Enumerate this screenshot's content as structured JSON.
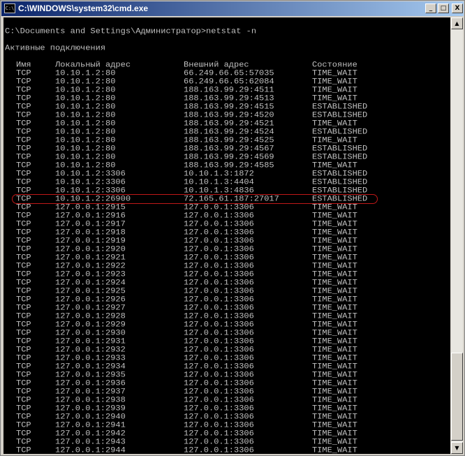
{
  "window": {
    "title": "C:\\WINDOWS\\system32\\cmd.exe",
    "icon_label": "C:\\",
    "icons": {
      "minimize": "minimize-icon",
      "maximize": "maximize-icon",
      "close": "close-icon"
    },
    "buttons": {
      "minimize": "_",
      "maximize": "□",
      "close": "X"
    }
  },
  "console": {
    "command": "C:\\Documents and Settings\\Администратор>netstat -n",
    "heading": "Активные подключения",
    "columns": {
      "proto": "Имя",
      "local": "Локальный адрес",
      "foreign": "Внешний адрес",
      "state": "Состояние"
    },
    "highlight_color": "#c01818",
    "highlighted_row": 13,
    "rows": [
      {
        "proto": "TCP",
        "local": "10.10.1.2:80",
        "foreign": "66.249.66.65:57035",
        "state": "TIME_WAIT"
      },
      {
        "proto": "TCP",
        "local": "10.10.1.2:80",
        "foreign": "66.249.66.65:62084",
        "state": "TIME_WAIT"
      },
      {
        "proto": "TCP",
        "local": "10.10.1.2:80",
        "foreign": "188.163.99.29:4511",
        "state": "TIME_WAIT"
      },
      {
        "proto": "TCP",
        "local": "10.10.1.2:80",
        "foreign": "188.163.99.29:4513",
        "state": "TIME_WAIT"
      },
      {
        "proto": "TCP",
        "local": "10.10.1.2:80",
        "foreign": "188.163.99.29:4515",
        "state": "ESTABLISHED"
      },
      {
        "proto": "TCP",
        "local": "10.10.1.2:80",
        "foreign": "188.163.99.29:4520",
        "state": "ESTABLISHED"
      },
      {
        "proto": "TCP",
        "local": "10.10.1.2:80",
        "foreign": "188.163.99.29:4521",
        "state": "TIME_WAIT"
      },
      {
        "proto": "TCP",
        "local": "10.10.1.2:80",
        "foreign": "188.163.99.29:4524",
        "state": "ESTABLISHED"
      },
      {
        "proto": "TCP",
        "local": "10.10.1.2:80",
        "foreign": "188.163.99.29:4525",
        "state": "TIME_WAIT"
      },
      {
        "proto": "TCP",
        "local": "10.10.1.2:80",
        "foreign": "188.163.99.29:4567",
        "state": "ESTABLISHED"
      },
      {
        "proto": "TCP",
        "local": "10.10.1.2:80",
        "foreign": "188.163.99.29:4569",
        "state": "ESTABLISHED"
      },
      {
        "proto": "TCP",
        "local": "10.10.1.2:80",
        "foreign": "188.163.99.29:4585",
        "state": "TIME_WAIT"
      },
      {
        "proto": "TCP",
        "local": "10.10.1.2:3306",
        "foreign": "10.10.1.3:1872",
        "state": "ESTABLISHED"
      },
      {
        "proto": "TCP",
        "local": "10.10.1.2:3306",
        "foreign": "10.10.1.3:4404",
        "state": "ESTABLISHED"
      },
      {
        "proto": "TCP",
        "local": "10.10.1.2:3306",
        "foreign": "10.10.1.3:4836",
        "state": "ESTABLISHED"
      },
      {
        "proto": "TCP",
        "local": "10.10.1.2:26900",
        "foreign": "72.165.61.187:27017",
        "state": "ESTABLISHED"
      },
      {
        "proto": "TCP",
        "local": "127.0.0.1:2915",
        "foreign": "127.0.0.1:3306",
        "state": "TIME_WAIT"
      },
      {
        "proto": "TCP",
        "local": "127.0.0.1:2916",
        "foreign": "127.0.0.1:3306",
        "state": "TIME_WAIT"
      },
      {
        "proto": "TCP",
        "local": "127.0.0.1:2917",
        "foreign": "127.0.0.1:3306",
        "state": "TIME_WAIT"
      },
      {
        "proto": "TCP",
        "local": "127.0.0.1:2918",
        "foreign": "127.0.0.1:3306",
        "state": "TIME_WAIT"
      },
      {
        "proto": "TCP",
        "local": "127.0.0.1:2919",
        "foreign": "127.0.0.1:3306",
        "state": "TIME_WAIT"
      },
      {
        "proto": "TCP",
        "local": "127.0.0.1:2920",
        "foreign": "127.0.0.1:3306",
        "state": "TIME_WAIT"
      },
      {
        "proto": "TCP",
        "local": "127.0.0.1:2921",
        "foreign": "127.0.0.1:3306",
        "state": "TIME_WAIT"
      },
      {
        "proto": "TCP",
        "local": "127.0.0.1:2922",
        "foreign": "127.0.0.1:3306",
        "state": "TIME_WAIT"
      },
      {
        "proto": "TCP",
        "local": "127.0.0.1:2923",
        "foreign": "127.0.0.1:3306",
        "state": "TIME_WAIT"
      },
      {
        "proto": "TCP",
        "local": "127.0.0.1:2924",
        "foreign": "127.0.0.1:3306",
        "state": "TIME_WAIT"
      },
      {
        "proto": "TCP",
        "local": "127.0.0.1:2925",
        "foreign": "127.0.0.1:3306",
        "state": "TIME_WAIT"
      },
      {
        "proto": "TCP",
        "local": "127.0.0.1:2926",
        "foreign": "127.0.0.1:3306",
        "state": "TIME_WAIT"
      },
      {
        "proto": "TCP",
        "local": "127.0.0.1:2927",
        "foreign": "127.0.0.1:3306",
        "state": "TIME_WAIT"
      },
      {
        "proto": "TCP",
        "local": "127.0.0.1:2928",
        "foreign": "127.0.0.1:3306",
        "state": "TIME_WAIT"
      },
      {
        "proto": "TCP",
        "local": "127.0.0.1:2929",
        "foreign": "127.0.0.1:3306",
        "state": "TIME_WAIT"
      },
      {
        "proto": "TCP",
        "local": "127.0.0.1:2930",
        "foreign": "127.0.0.1:3306",
        "state": "TIME_WAIT"
      },
      {
        "proto": "TCP",
        "local": "127.0.0.1:2931",
        "foreign": "127.0.0.1:3306",
        "state": "TIME_WAIT"
      },
      {
        "proto": "TCP",
        "local": "127.0.0.1:2932",
        "foreign": "127.0.0.1:3306",
        "state": "TIME_WAIT"
      },
      {
        "proto": "TCP",
        "local": "127.0.0.1:2933",
        "foreign": "127.0.0.1:3306",
        "state": "TIME_WAIT"
      },
      {
        "proto": "TCP",
        "local": "127.0.0.1:2934",
        "foreign": "127.0.0.1:3306",
        "state": "TIME_WAIT"
      },
      {
        "proto": "TCP",
        "local": "127.0.0.1:2935",
        "foreign": "127.0.0.1:3306",
        "state": "TIME_WAIT"
      },
      {
        "proto": "TCP",
        "local": "127.0.0.1:2936",
        "foreign": "127.0.0.1:3306",
        "state": "TIME_WAIT"
      },
      {
        "proto": "TCP",
        "local": "127.0.0.1:2937",
        "foreign": "127.0.0.1:3306",
        "state": "TIME_WAIT"
      },
      {
        "proto": "TCP",
        "local": "127.0.0.1:2938",
        "foreign": "127.0.0.1:3306",
        "state": "TIME_WAIT"
      },
      {
        "proto": "TCP",
        "local": "127.0.0.1:2939",
        "foreign": "127.0.0.1:3306",
        "state": "TIME_WAIT"
      },
      {
        "proto": "TCP",
        "local": "127.0.0.1:2940",
        "foreign": "127.0.0.1:3306",
        "state": "TIME_WAIT"
      },
      {
        "proto": "TCP",
        "local": "127.0.0.1:2941",
        "foreign": "127.0.0.1:3306",
        "state": "TIME_WAIT"
      },
      {
        "proto": "TCP",
        "local": "127.0.0.1:2942",
        "foreign": "127.0.0.1:3306",
        "state": "TIME_WAIT"
      },
      {
        "proto": "TCP",
        "local": "127.0.0.1:2943",
        "foreign": "127.0.0.1:3306",
        "state": "TIME_WAIT"
      },
      {
        "proto": "TCP",
        "local": "127.0.0.1:2944",
        "foreign": "127.0.0.1:3306",
        "state": "TIME_WAIT"
      }
    ]
  }
}
